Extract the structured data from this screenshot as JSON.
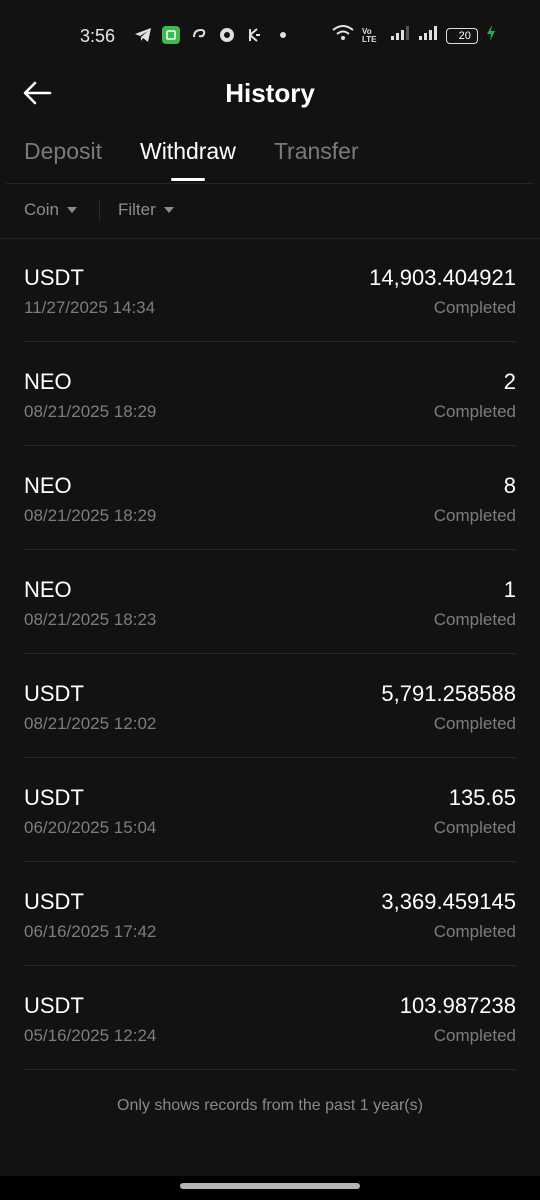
{
  "status_bar": {
    "time": "3:56",
    "battery_level": 20,
    "battery_label": "20",
    "network_label": "Vo LTE",
    "icons": [
      "telegram-icon",
      "app-icon",
      "swirl-icon",
      "gear-badge-icon",
      "kucoin-icon",
      "dot-icon"
    ],
    "right_icons": [
      "wifi-icon",
      "volte-icon",
      "signal-icon",
      "signal-icon",
      "battery-icon",
      "charging-icon"
    ]
  },
  "header": {
    "title": "History",
    "back_icon": "arrow-left-icon"
  },
  "tabs": [
    {
      "label": "Deposit",
      "active": false
    },
    {
      "label": "Withdraw",
      "active": true
    },
    {
      "label": "Transfer",
      "active": false
    }
  ],
  "filters": [
    {
      "label": "Coin"
    },
    {
      "label": "Filter"
    }
  ],
  "records": [
    {
      "coin": "USDT",
      "date": "11/27/2025 14:34",
      "amount": "14,903.404921",
      "status": "Completed"
    },
    {
      "coin": "NEO",
      "date": "08/21/2025 18:29",
      "amount": "2",
      "status": "Completed"
    },
    {
      "coin": "NEO",
      "date": "08/21/2025 18:29",
      "amount": "8",
      "status": "Completed"
    },
    {
      "coin": "NEO",
      "date": "08/21/2025 18:23",
      "amount": "1",
      "status": "Completed"
    },
    {
      "coin": "USDT",
      "date": "08/21/2025 12:02",
      "amount": "5,791.258588",
      "status": "Completed"
    },
    {
      "coin": "USDT",
      "date": "06/20/2025 15:04",
      "amount": "135.65",
      "status": "Completed"
    },
    {
      "coin": "USDT",
      "date": "06/16/2025 17:42",
      "amount": "3,369.459145",
      "status": "Completed"
    },
    {
      "coin": "USDT",
      "date": "05/16/2025 12:24",
      "amount": "103.987238",
      "status": "Completed"
    }
  ],
  "footer_note": "Only shows records from the past 1 year(s)",
  "colors": {
    "background": "#121212",
    "text_primary": "#ffffff",
    "text_secondary": "#7d7d7d",
    "accent_green": "#2ea84d"
  }
}
